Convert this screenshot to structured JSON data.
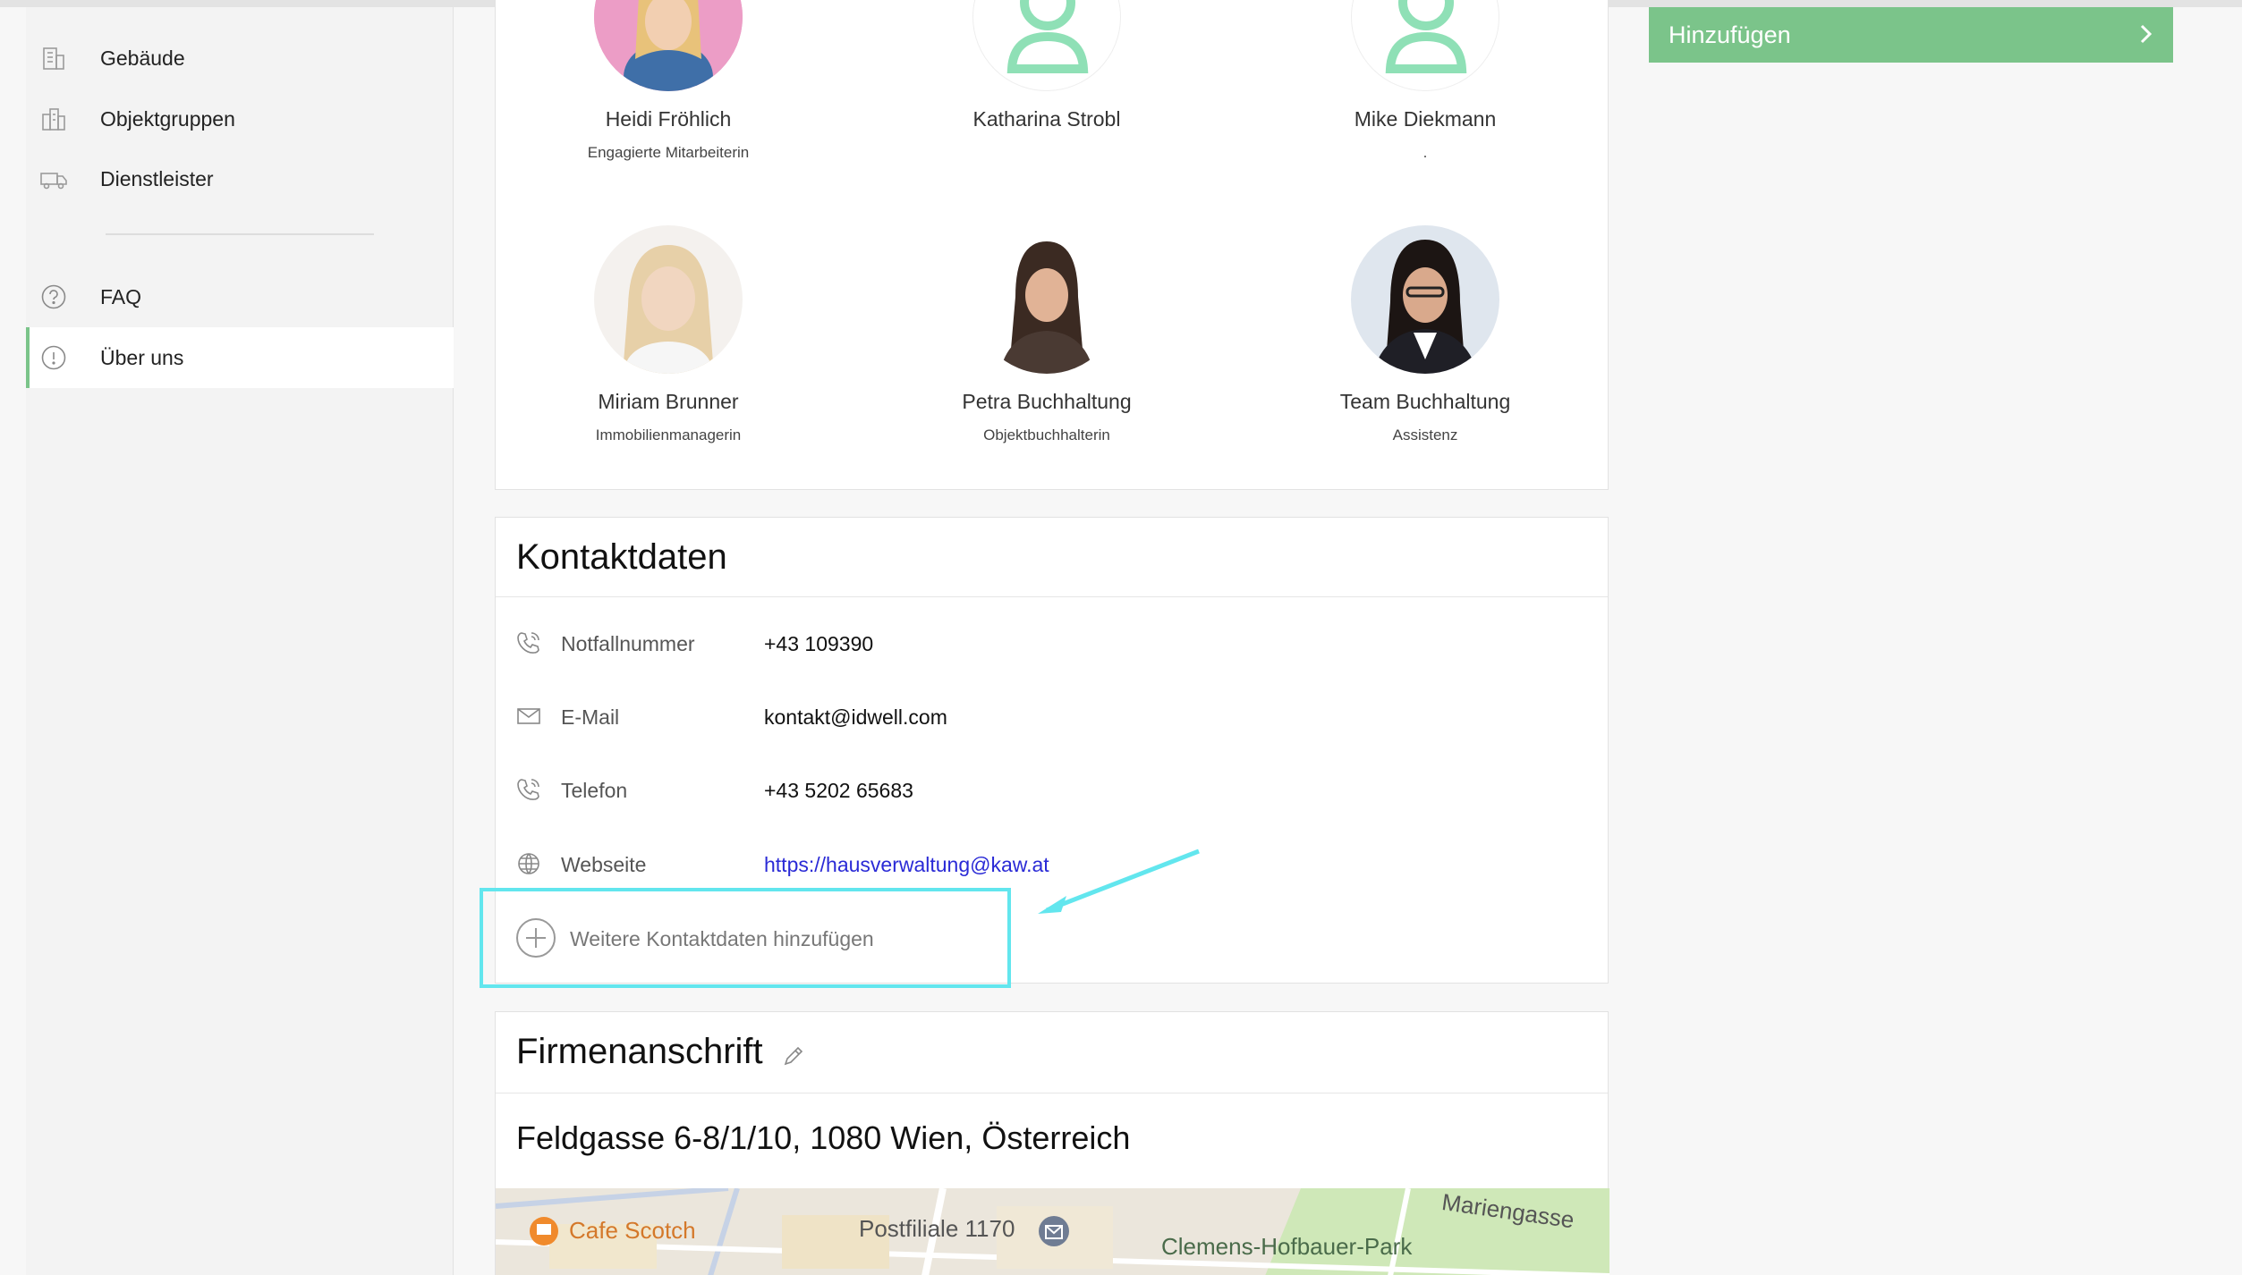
{
  "sidebar": {
    "items": [
      {
        "label": "Gebäude",
        "icon": "building-icon"
      },
      {
        "label": "Objektgruppen",
        "icon": "building-group-icon"
      },
      {
        "label": "Dienstleister",
        "icon": "truck-icon"
      },
      {
        "label": "FAQ",
        "icon": "question-icon"
      },
      {
        "label": "Über uns",
        "icon": "info-icon",
        "active": true
      }
    ]
  },
  "team": {
    "members": [
      {
        "name": "Heidi Fröhlich",
        "role": "Engagierte Mitarbeiterin",
        "avatar": "photo"
      },
      {
        "name": "Katharina Strobl",
        "role": "",
        "avatar": "placeholder"
      },
      {
        "name": "Mike Diekmann",
        "role": ".",
        "avatar": "placeholder"
      },
      {
        "name": "Miriam Brunner",
        "role": "Immobilienmanagerin",
        "avatar": "photo"
      },
      {
        "name": "Petra Buchhaltung",
        "role": "Objektbuchhalterin",
        "avatar": "photo"
      },
      {
        "name": "Team Buchhaltung",
        "role": "Assistenz",
        "avatar": "photo"
      }
    ]
  },
  "kontakt": {
    "title": "Kontaktdaten",
    "rows": [
      {
        "label": "Notfallnummer",
        "value": "+43 109390",
        "icon": "phone-icon"
      },
      {
        "label": "E-Mail",
        "value": "kontakt@idwell.com",
        "icon": "mail-icon"
      },
      {
        "label": "Telefon",
        "value": "+43 5202 65683",
        "icon": "phone-icon"
      },
      {
        "label": "Webseite",
        "value": "https://hausverwaltung@kaw.at",
        "icon": "globe-icon"
      }
    ],
    "add_label": "Weitere Kontaktdaten hinzufügen"
  },
  "firma": {
    "title": "Firmenanschrift",
    "address": "Feldgasse 6-8/1/10, 1080 Wien, Österreich",
    "map_labels": {
      "cafe": "Cafe Scotch",
      "post": "Postfiliale 1170",
      "park": "Clemens-Hofbauer-Park",
      "street": "Mariengasse"
    }
  },
  "actions": {
    "add_button": "Hinzufügen"
  },
  "colors": {
    "accent": "#7bc48a",
    "placeholder_avatar": "#8fe0b6",
    "highlight": "#62e6ee",
    "link": "#2a2ad6"
  }
}
